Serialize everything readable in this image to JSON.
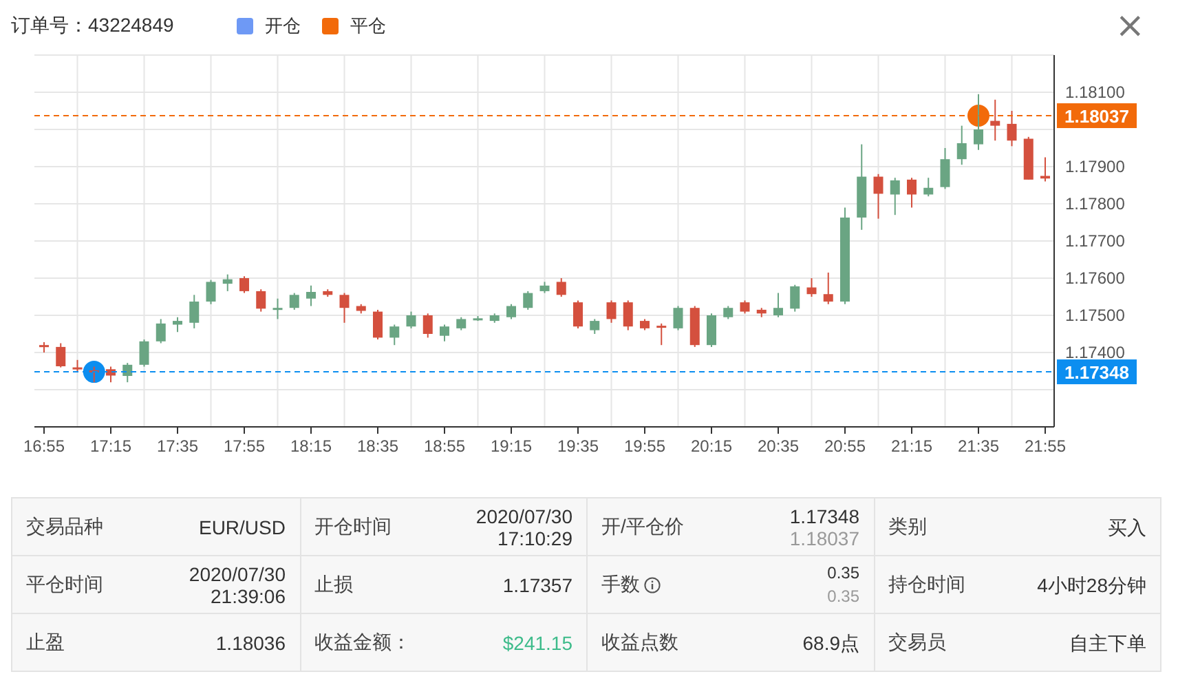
{
  "header": {
    "order_label": "订单号：43224849",
    "legend": [
      {
        "label": "开仓",
        "color": "#6e99f5"
      },
      {
        "label": "平仓",
        "color": "#f26a0a"
      }
    ],
    "close": "×"
  },
  "chart": {
    "chart_data": {
      "type": "candlestick",
      "grid": true,
      "categories": [
        "16:55",
        null,
        null,
        null,
        "17:15",
        null,
        null,
        null,
        "17:35",
        null,
        null,
        null,
        "17:55",
        null,
        null,
        null,
        "18:15",
        null,
        null,
        null,
        "18:35",
        null,
        null,
        null,
        "18:55",
        null,
        null,
        null,
        "19:15",
        null,
        null,
        null,
        "19:35",
        null,
        null,
        null,
        "19:55",
        null,
        null,
        null,
        "20:15",
        null,
        null,
        null,
        "20:35",
        null,
        null,
        null,
        "20:55",
        null,
        null,
        null,
        "21:15",
        null,
        null,
        null,
        "21:35",
        null,
        null,
        null,
        "21:55"
      ],
      "ohlc": [
        [
          1.1742,
          1.17428,
          1.174,
          1.17415
        ],
        [
          1.17415,
          1.17425,
          1.1736,
          1.17363
        ],
        [
          1.1736,
          1.1738,
          1.1735,
          1.17358
        ],
        [
          1.17352,
          1.17362,
          1.1732,
          1.17348
        ],
        [
          1.17355,
          1.17362,
          1.1732,
          1.17338
        ],
        [
          1.17337,
          1.17372,
          1.1732,
          1.17367
        ],
        [
          1.17367,
          1.17435,
          1.17362,
          1.1743
        ],
        [
          1.1743,
          1.1749,
          1.17425,
          1.17478
        ],
        [
          1.17475,
          1.17495,
          1.17455,
          1.17485
        ],
        [
          1.1748,
          1.17555,
          1.17465,
          1.17537
        ],
        [
          1.17537,
          1.17595,
          1.1753,
          1.1759
        ],
        [
          1.17585,
          1.1761,
          1.17565,
          1.17597
        ],
        [
          1.176,
          1.17605,
          1.1756,
          1.17565
        ],
        [
          1.17565,
          1.1757,
          1.1751,
          1.17518
        ],
        [
          1.17518,
          1.17545,
          1.1749,
          1.1752
        ],
        [
          1.1752,
          1.1756,
          1.17515,
          1.17555
        ],
        [
          1.17545,
          1.1758,
          1.17525,
          1.17563
        ],
        [
          1.17565,
          1.1757,
          1.1755,
          1.17555
        ],
        [
          1.17555,
          1.1756,
          1.1748,
          1.1752
        ],
        [
          1.17525,
          1.1753,
          1.17505,
          1.17512
        ],
        [
          1.1751,
          1.17515,
          1.17435,
          1.1744
        ],
        [
          1.1744,
          1.17475,
          1.1742,
          1.1747
        ],
        [
          1.1747,
          1.1751,
          1.17465,
          1.175
        ],
        [
          1.175,
          1.17505,
          1.1744,
          1.1745
        ],
        [
          1.17445,
          1.17475,
          1.1743,
          1.1747
        ],
        [
          1.17465,
          1.17495,
          1.1746,
          1.1749
        ],
        [
          1.1749,
          1.17498,
          1.17485,
          1.17492
        ],
        [
          1.17485,
          1.17505,
          1.1748,
          1.175
        ],
        [
          1.17495,
          1.1753,
          1.1749,
          1.17525
        ],
        [
          1.1752,
          1.17565,
          1.17515,
          1.1756
        ],
        [
          1.17565,
          1.1759,
          1.1756,
          1.1758
        ],
        [
          1.1759,
          1.176,
          1.1755,
          1.17555
        ],
        [
          1.17535,
          1.1754,
          1.17465,
          1.1747
        ],
        [
          1.1746,
          1.1749,
          1.1745,
          1.17485
        ],
        [
          1.17535,
          1.1754,
          1.1748,
          1.1749
        ],
        [
          1.17535,
          1.1754,
          1.1746,
          1.1747
        ],
        [
          1.17485,
          1.1749,
          1.1746,
          1.17465
        ],
        [
          1.17472,
          1.17478,
          1.1742,
          1.1747
        ],
        [
          1.17465,
          1.17525,
          1.1746,
          1.1752
        ],
        [
          1.1752,
          1.17525,
          1.17415,
          1.1742
        ],
        [
          1.1742,
          1.17505,
          1.17415,
          1.175
        ],
        [
          1.17495,
          1.17525,
          1.1749,
          1.1752
        ],
        [
          1.17535,
          1.1754,
          1.17505,
          1.1751
        ],
        [
          1.17515,
          1.1752,
          1.17495,
          1.17505
        ],
        [
          1.175,
          1.1756,
          1.17495,
          1.1752
        ],
        [
          1.17518,
          1.17582,
          1.1751,
          1.17578
        ],
        [
          1.17575,
          1.176,
          1.1755,
          1.17557
        ],
        [
          1.17557,
          1.17615,
          1.1753,
          1.17537
        ],
        [
          1.17537,
          1.1779,
          1.1753,
          1.17763
        ],
        [
          1.17763,
          1.1796,
          1.1773,
          1.17873
        ],
        [
          1.17873,
          1.1788,
          1.1776,
          1.17827
        ],
        [
          1.17825,
          1.1787,
          1.1777,
          1.17863
        ],
        [
          1.17865,
          1.1787,
          1.1779,
          1.17825
        ],
        [
          1.17825,
          1.1787,
          1.1782,
          1.17843
        ],
        [
          1.17845,
          1.1795,
          1.1784,
          1.1792
        ],
        [
          1.1792,
          1.1801,
          1.17905,
          1.17963
        ],
        [
          1.1796,
          1.18095,
          1.17945,
          1.18
        ],
        [
          1.18023,
          1.1808,
          1.1797,
          1.1801
        ],
        [
          1.18015,
          1.1805,
          1.17955,
          1.1797
        ],
        [
          1.17975,
          1.1798,
          1.17865,
          1.17865
        ],
        [
          1.17875,
          1.17925,
          1.1786,
          1.17868
        ]
      ],
      "ylim": [
        1.172,
        1.182
      ],
      "yticks": [
        {
          "value": 1.174,
          "label": "1.17400"
        },
        {
          "value": 1.175,
          "label": "1.17500"
        },
        {
          "value": 1.176,
          "label": "1.17600"
        },
        {
          "value": 1.177,
          "label": "1.17700"
        },
        {
          "value": 1.178,
          "label": "1.17800"
        },
        {
          "value": 1.179,
          "label": "1.17900"
        },
        {
          "value": 1.181,
          "label": "1.18100"
        }
      ],
      "ref_lines": [
        {
          "axis": "y",
          "value": 1.17348,
          "label": "1.17348",
          "color": "#0c8ef0"
        },
        {
          "axis": "y",
          "value": 1.18037,
          "label": "1.18037",
          "color": "#f26a0a"
        }
      ]
    }
  },
  "details": [
    {
      "label": "交易品种",
      "values": [
        {
          "text": "EUR/USD",
          "muted": false
        }
      ]
    },
    {
      "label": "开仓时间",
      "values": [
        {
          "text": "2020/07/30",
          "muted": false
        },
        {
          "text": "17:10:29",
          "muted": false
        }
      ]
    },
    {
      "label": "开/平仓价",
      "values": [
        {
          "text": "1.17348",
          "muted": false
        },
        {
          "text": "1.18037",
          "muted": true
        }
      ]
    },
    {
      "label": "类别",
      "values": [
        {
          "text": "买入",
          "muted": false
        }
      ]
    },
    {
      "label": "平仓时间",
      "values": [
        {
          "text": "2020/07/30",
          "muted": false
        },
        {
          "text": "21:39:06",
          "muted": false
        }
      ]
    },
    {
      "label": "止损",
      "values": [
        {
          "text": "1.17357",
          "muted": false
        }
      ]
    },
    {
      "label": "手数",
      "info": true,
      "values": [
        {
          "text": "0.35",
          "muted": false,
          "small": true
        },
        {
          "text": "0.35",
          "muted": true,
          "small": true
        }
      ]
    },
    {
      "label": "持仓时间",
      "values": [
        {
          "text": "4小时28分钟",
          "muted": false
        }
      ]
    },
    {
      "label": "止盈",
      "values": [
        {
          "text": "1.18036",
          "muted": false
        }
      ]
    },
    {
      "label": "收益金额：",
      "kind": "profit",
      "values": [
        {
          "text": "$241.15",
          "muted": false
        }
      ]
    },
    {
      "label": "收益点数",
      "values": [
        {
          "text": "68.9点",
          "muted": false
        }
      ]
    },
    {
      "label": "交易员",
      "values": [
        {
          "text": "自主下单",
          "muted": false
        }
      ]
    }
  ]
}
